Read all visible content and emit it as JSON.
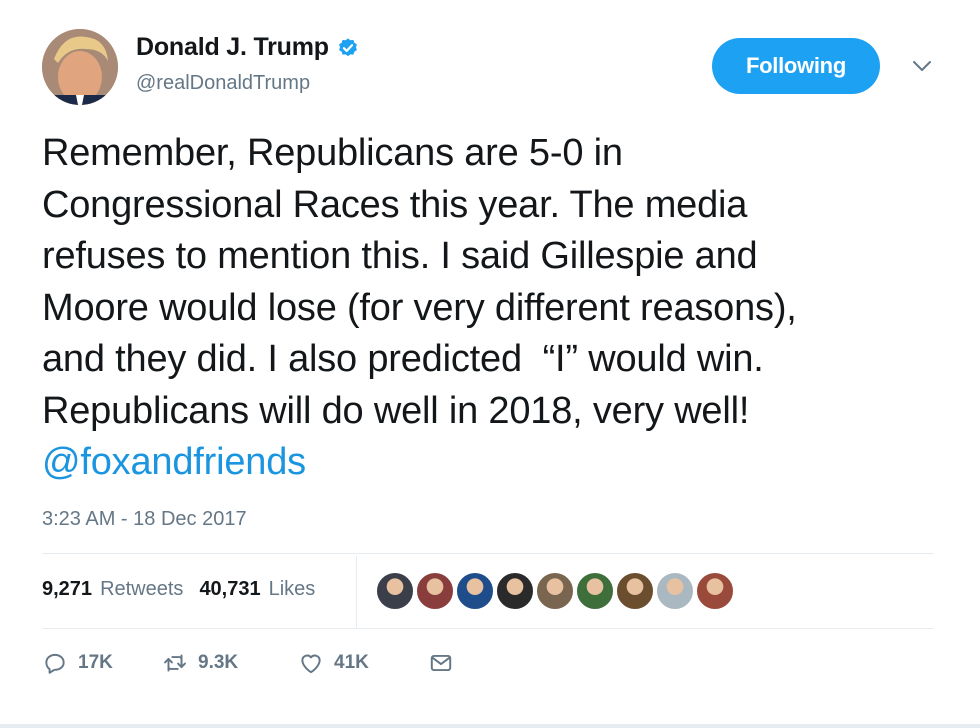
{
  "author": {
    "display_name": "Donald J. Trump",
    "handle": "@realDonaldTrump",
    "verified": true,
    "avatar_icon": "profile-photo"
  },
  "follow_button_label": "Following",
  "menu_icon": "chevron-down-icon",
  "tweet": {
    "lines": [
      "Remember, Republicans are 5-0 in",
      "Congressional Races this year. The media",
      "refuses to mention this. I said Gillespie and",
      "Moore would lose (for very different reasons),",
      "and they did. I also predicted  “I” would win.",
      "Republicans will do well in 2018, very well!"
    ],
    "mention": "@foxandfriends"
  },
  "timestamp": "3:23 AM - 18 Dec 2017",
  "stats": {
    "retweets_count": "9,271",
    "retweets_label": "Retweets",
    "likes_count": "40,731",
    "likes_label": "Likes"
  },
  "liked_by_faces": [
    "#3b3f4a",
    "#8a3d3d",
    "#1f4d8c",
    "#2a2a2a",
    "#7a6650",
    "#3e6e3a",
    "#6b4e2e",
    "#aab8c2",
    "#9a4a3a"
  ],
  "actions": {
    "reply_count": "17K",
    "retweet_count": "9.3K",
    "like_count": "41K"
  },
  "colors": {
    "accent": "#1da1f2",
    "link": "#1b95e0",
    "muted": "#657786",
    "text": "#14171a"
  }
}
